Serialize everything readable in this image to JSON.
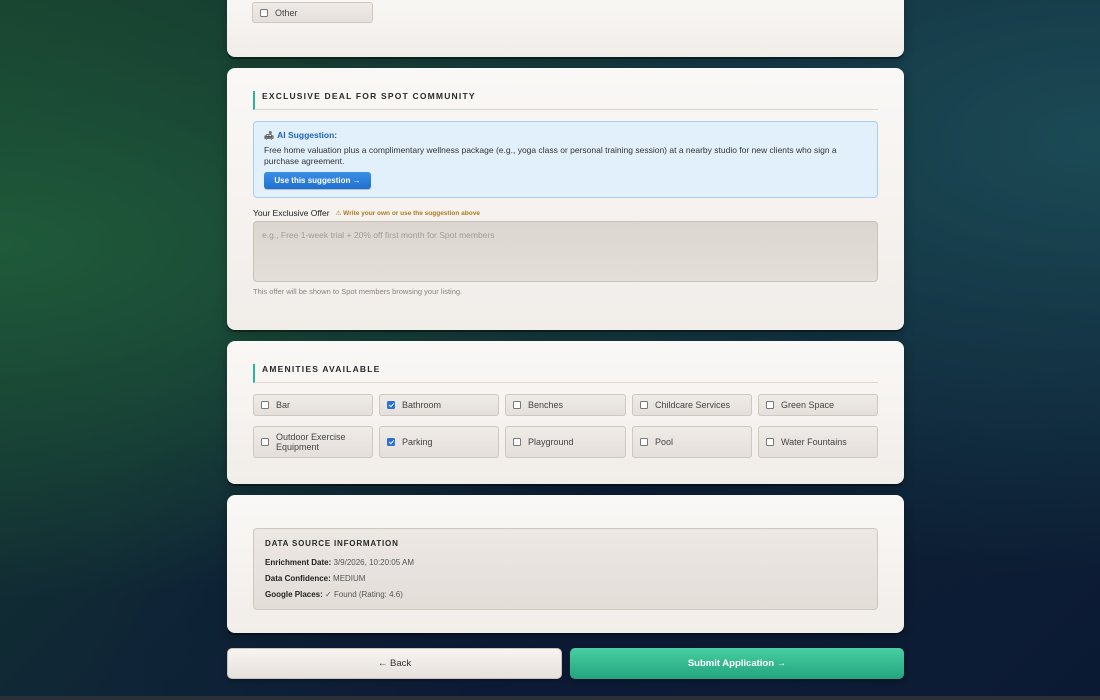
{
  "prev_section": {
    "other_label": "Other",
    "other_checked": false
  },
  "deal_section": {
    "title": "EXCLUSIVE DEAL FOR SPOT COMMUNITY",
    "ai_icon": "🛋",
    "ai_title": "AI Suggestion:",
    "ai_text": "Free home valuation plus a complimentary wellness package (e.g., yoga class or personal training session) at a nearby studio for new clients who sign a purchase agreement.",
    "ai_button": "Use this suggestion →",
    "offer_label": "Your Exclusive Offer",
    "offer_hint": "⚠ Write your own or use the suggestion above",
    "offer_value": "",
    "offer_placeholder": "e.g., Free 1-week trial + 20% off first month for Spot members",
    "offer_help": "This offer will be shown to Spot members browsing your listing."
  },
  "amenities_section": {
    "title": "AMENITIES AVAILABLE",
    "items": [
      {
        "label": "Bar",
        "checked": false
      },
      {
        "label": "Bathroom",
        "checked": true
      },
      {
        "label": "Benches",
        "checked": false
      },
      {
        "label": "Childcare Services",
        "checked": false
      },
      {
        "label": "Green Space",
        "checked": false
      },
      {
        "label": "Outdoor Exercise Equipment",
        "checked": false
      },
      {
        "label": "Parking",
        "checked": true
      },
      {
        "label": "Playground",
        "checked": false
      },
      {
        "label": "Pool",
        "checked": false
      },
      {
        "label": "Water Fountains",
        "checked": false
      }
    ]
  },
  "data_source": {
    "title": "DATA SOURCE INFORMATION",
    "enrichment_label": "Enrichment Date:",
    "enrichment_value": "3/9/2026, 10:20:05 AM",
    "confidence_label": "Data Confidence:",
    "confidence_value": "MEDIUM",
    "google_label": "Google Places:",
    "google_value": "✓ Found (Rating: 4.6)"
  },
  "actions": {
    "back_label": "← Back",
    "submit_label": "Submit Application →"
  },
  "colors": {
    "accent": "#2bb59a",
    "submit": "#2fb98d",
    "link_blue": "#1f6fcf",
    "warning": "#b07a1f"
  }
}
